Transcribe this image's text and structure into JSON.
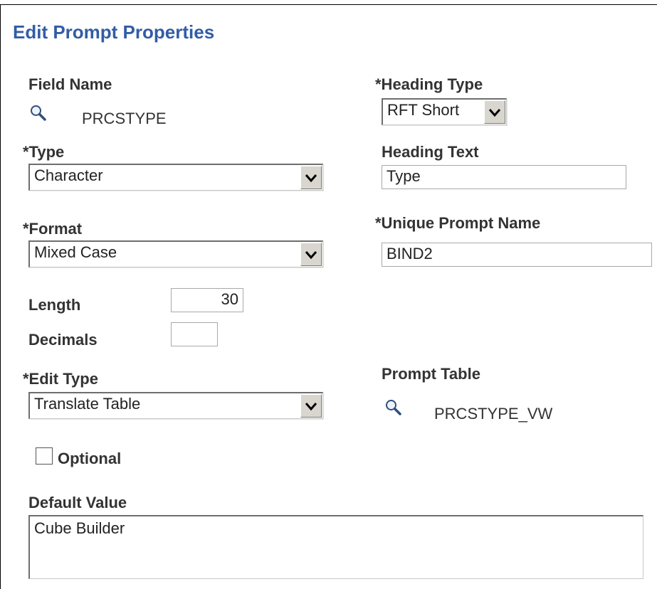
{
  "page": {
    "title": "Edit Prompt Properties"
  },
  "field_name": {
    "label": "Field Name",
    "value": "PRCSTYPE",
    "lookup_icon": "search-icon"
  },
  "heading_type": {
    "label": "*Heading Type",
    "value": "RFT Short"
  },
  "type": {
    "label": "*Type",
    "value": "Character"
  },
  "heading_text": {
    "label": "Heading Text",
    "value": "Type"
  },
  "format": {
    "label": "*Format",
    "value": "Mixed Case"
  },
  "unique_prompt_name": {
    "label": "*Unique Prompt Name",
    "value": "BIND2"
  },
  "length": {
    "label": "Length",
    "value": "30"
  },
  "decimals": {
    "label": "Decimals",
    "value": ""
  },
  "edit_type": {
    "label": "*Edit Type",
    "value": "Translate Table"
  },
  "prompt_table": {
    "label": "Prompt Table",
    "value": "PRCSTYPE_VW",
    "lookup_icon": "search-icon"
  },
  "optional": {
    "label": "Optional",
    "checked": false
  },
  "default_value": {
    "label": "Default Value",
    "value": "Cube Builder"
  },
  "colors": {
    "title": "#325da6",
    "label": "#333333"
  }
}
